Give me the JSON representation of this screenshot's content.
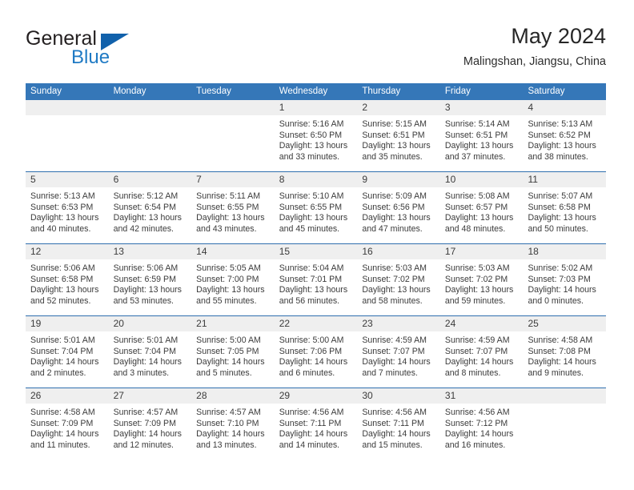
{
  "brand": {
    "name_part1": "General",
    "name_part2": "Blue",
    "triangle_color": "#1161ab",
    "blue_color": "#1f7ac4"
  },
  "header": {
    "title": "May 2024",
    "subtitle": "Malingshan, Jiangsu, China"
  },
  "theme": {
    "header_blue": "#3577b8",
    "week_divider_blue": "#2f6fae",
    "number_band_gray": "#efefef",
    "text_color": "#3b3b3b"
  },
  "weekdays": [
    "Sunday",
    "Monday",
    "Tuesday",
    "Wednesday",
    "Thursday",
    "Friday",
    "Saturday"
  ],
  "weeks": [
    {
      "days": [
        {
          "num": "",
          "sunrise": "",
          "sunset": "",
          "daylight_1": "",
          "daylight_2": "",
          "empty": true
        },
        {
          "num": "",
          "sunrise": "",
          "sunset": "",
          "daylight_1": "",
          "daylight_2": "",
          "empty": true
        },
        {
          "num": "",
          "sunrise": "",
          "sunset": "",
          "daylight_1": "",
          "daylight_2": "",
          "empty": true
        },
        {
          "num": "1",
          "sunrise": "Sunrise: 5:16 AM",
          "sunset": "Sunset: 6:50 PM",
          "daylight_1": "Daylight: 13 hours",
          "daylight_2": "and 33 minutes.",
          "empty": false
        },
        {
          "num": "2",
          "sunrise": "Sunrise: 5:15 AM",
          "sunset": "Sunset: 6:51 PM",
          "daylight_1": "Daylight: 13 hours",
          "daylight_2": "and 35 minutes.",
          "empty": false
        },
        {
          "num": "3",
          "sunrise": "Sunrise: 5:14 AM",
          "sunset": "Sunset: 6:51 PM",
          "daylight_1": "Daylight: 13 hours",
          "daylight_2": "and 37 minutes.",
          "empty": false
        },
        {
          "num": "4",
          "sunrise": "Sunrise: 5:13 AM",
          "sunset": "Sunset: 6:52 PM",
          "daylight_1": "Daylight: 13 hours",
          "daylight_2": "and 38 minutes.",
          "empty": false
        }
      ]
    },
    {
      "days": [
        {
          "num": "5",
          "sunrise": "Sunrise: 5:13 AM",
          "sunset": "Sunset: 6:53 PM",
          "daylight_1": "Daylight: 13 hours",
          "daylight_2": "and 40 minutes.",
          "empty": false
        },
        {
          "num": "6",
          "sunrise": "Sunrise: 5:12 AM",
          "sunset": "Sunset: 6:54 PM",
          "daylight_1": "Daylight: 13 hours",
          "daylight_2": "and 42 minutes.",
          "empty": false
        },
        {
          "num": "7",
          "sunrise": "Sunrise: 5:11 AM",
          "sunset": "Sunset: 6:55 PM",
          "daylight_1": "Daylight: 13 hours",
          "daylight_2": "and 43 minutes.",
          "empty": false
        },
        {
          "num": "8",
          "sunrise": "Sunrise: 5:10 AM",
          "sunset": "Sunset: 6:55 PM",
          "daylight_1": "Daylight: 13 hours",
          "daylight_2": "and 45 minutes.",
          "empty": false
        },
        {
          "num": "9",
          "sunrise": "Sunrise: 5:09 AM",
          "sunset": "Sunset: 6:56 PM",
          "daylight_1": "Daylight: 13 hours",
          "daylight_2": "and 47 minutes.",
          "empty": false
        },
        {
          "num": "10",
          "sunrise": "Sunrise: 5:08 AM",
          "sunset": "Sunset: 6:57 PM",
          "daylight_1": "Daylight: 13 hours",
          "daylight_2": "and 48 minutes.",
          "empty": false
        },
        {
          "num": "11",
          "sunrise": "Sunrise: 5:07 AM",
          "sunset": "Sunset: 6:58 PM",
          "daylight_1": "Daylight: 13 hours",
          "daylight_2": "and 50 minutes.",
          "empty": false
        }
      ]
    },
    {
      "days": [
        {
          "num": "12",
          "sunrise": "Sunrise: 5:06 AM",
          "sunset": "Sunset: 6:58 PM",
          "daylight_1": "Daylight: 13 hours",
          "daylight_2": "and 52 minutes.",
          "empty": false
        },
        {
          "num": "13",
          "sunrise": "Sunrise: 5:06 AM",
          "sunset": "Sunset: 6:59 PM",
          "daylight_1": "Daylight: 13 hours",
          "daylight_2": "and 53 minutes.",
          "empty": false
        },
        {
          "num": "14",
          "sunrise": "Sunrise: 5:05 AM",
          "sunset": "Sunset: 7:00 PM",
          "daylight_1": "Daylight: 13 hours",
          "daylight_2": "and 55 minutes.",
          "empty": false
        },
        {
          "num": "15",
          "sunrise": "Sunrise: 5:04 AM",
          "sunset": "Sunset: 7:01 PM",
          "daylight_1": "Daylight: 13 hours",
          "daylight_2": "and 56 minutes.",
          "empty": false
        },
        {
          "num": "16",
          "sunrise": "Sunrise: 5:03 AM",
          "sunset": "Sunset: 7:02 PM",
          "daylight_1": "Daylight: 13 hours",
          "daylight_2": "and 58 minutes.",
          "empty": false
        },
        {
          "num": "17",
          "sunrise": "Sunrise: 5:03 AM",
          "sunset": "Sunset: 7:02 PM",
          "daylight_1": "Daylight: 13 hours",
          "daylight_2": "and 59 minutes.",
          "empty": false
        },
        {
          "num": "18",
          "sunrise": "Sunrise: 5:02 AM",
          "sunset": "Sunset: 7:03 PM",
          "daylight_1": "Daylight: 14 hours",
          "daylight_2": "and 0 minutes.",
          "empty": false
        }
      ]
    },
    {
      "days": [
        {
          "num": "19",
          "sunrise": "Sunrise: 5:01 AM",
          "sunset": "Sunset: 7:04 PM",
          "daylight_1": "Daylight: 14 hours",
          "daylight_2": "and 2 minutes.",
          "empty": false
        },
        {
          "num": "20",
          "sunrise": "Sunrise: 5:01 AM",
          "sunset": "Sunset: 7:04 PM",
          "daylight_1": "Daylight: 14 hours",
          "daylight_2": "and 3 minutes.",
          "empty": false
        },
        {
          "num": "21",
          "sunrise": "Sunrise: 5:00 AM",
          "sunset": "Sunset: 7:05 PM",
          "daylight_1": "Daylight: 14 hours",
          "daylight_2": "and 5 minutes.",
          "empty": false
        },
        {
          "num": "22",
          "sunrise": "Sunrise: 5:00 AM",
          "sunset": "Sunset: 7:06 PM",
          "daylight_1": "Daylight: 14 hours",
          "daylight_2": "and 6 minutes.",
          "empty": false
        },
        {
          "num": "23",
          "sunrise": "Sunrise: 4:59 AM",
          "sunset": "Sunset: 7:07 PM",
          "daylight_1": "Daylight: 14 hours",
          "daylight_2": "and 7 minutes.",
          "empty": false
        },
        {
          "num": "24",
          "sunrise": "Sunrise: 4:59 AM",
          "sunset": "Sunset: 7:07 PM",
          "daylight_1": "Daylight: 14 hours",
          "daylight_2": "and 8 minutes.",
          "empty": false
        },
        {
          "num": "25",
          "sunrise": "Sunrise: 4:58 AM",
          "sunset": "Sunset: 7:08 PM",
          "daylight_1": "Daylight: 14 hours",
          "daylight_2": "and 9 minutes.",
          "empty": false
        }
      ]
    },
    {
      "days": [
        {
          "num": "26",
          "sunrise": "Sunrise: 4:58 AM",
          "sunset": "Sunset: 7:09 PM",
          "daylight_1": "Daylight: 14 hours",
          "daylight_2": "and 11 minutes.",
          "empty": false
        },
        {
          "num": "27",
          "sunrise": "Sunrise: 4:57 AM",
          "sunset": "Sunset: 7:09 PM",
          "daylight_1": "Daylight: 14 hours",
          "daylight_2": "and 12 minutes.",
          "empty": false
        },
        {
          "num": "28",
          "sunrise": "Sunrise: 4:57 AM",
          "sunset": "Sunset: 7:10 PM",
          "daylight_1": "Daylight: 14 hours",
          "daylight_2": "and 13 minutes.",
          "empty": false
        },
        {
          "num": "29",
          "sunrise": "Sunrise: 4:56 AM",
          "sunset": "Sunset: 7:11 PM",
          "daylight_1": "Daylight: 14 hours",
          "daylight_2": "and 14 minutes.",
          "empty": false
        },
        {
          "num": "30",
          "sunrise": "Sunrise: 4:56 AM",
          "sunset": "Sunset: 7:11 PM",
          "daylight_1": "Daylight: 14 hours",
          "daylight_2": "and 15 minutes.",
          "empty": false
        },
        {
          "num": "31",
          "sunrise": "Sunrise: 4:56 AM",
          "sunset": "Sunset: 7:12 PM",
          "daylight_1": "Daylight: 14 hours",
          "daylight_2": "and 16 minutes.",
          "empty": false
        },
        {
          "num": "",
          "sunrise": "",
          "sunset": "",
          "daylight_1": "",
          "daylight_2": "",
          "empty": true
        }
      ]
    }
  ]
}
